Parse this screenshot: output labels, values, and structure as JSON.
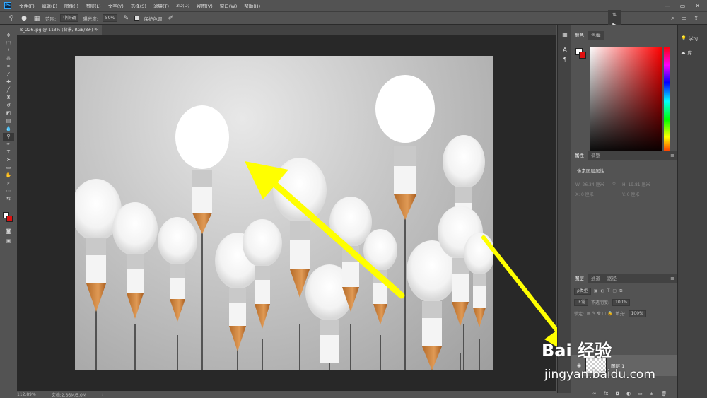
{
  "menubar": {
    "logo": "Ps",
    "items": [
      "文件(F)",
      "编辑(E)",
      "图像(I)",
      "图层(L)",
      "文字(Y)",
      "选择(S)",
      "滤镜(T)",
      "3D(D)",
      "视图(V)",
      "窗口(W)",
      "帮助(H)"
    ],
    "window_controls": [
      "—",
      "▭",
      "✕"
    ]
  },
  "options": {
    "range_label": "范围:",
    "range_value": "中间调",
    "exposure_label": "曝光度:",
    "exposure_value": "50%",
    "protect_tones_label": "保护色调"
  },
  "document": {
    "tab_title": "ls_226.jpg @ 113% (背景, RGB/8#) *",
    "close": "×"
  },
  "status": {
    "zoom": "112.89%",
    "doc_size": "文档:2.36M/5.0M",
    "arrow": "›"
  },
  "panels": {
    "color_tabs": [
      "颜色",
      "色板"
    ],
    "properties_tabs": [
      "属性",
      "调整"
    ],
    "properties_title": "像素图层属性",
    "prop_w": "W: 26.34 厘米",
    "prop_h": "H: 19.81 厘米",
    "prop_x": "X: 0 厘米",
    "prop_y": "Y: 0 厘米",
    "layers_tabs": [
      "图层",
      "通道",
      "路径"
    ],
    "layers_filter": "ρ类型",
    "blend_mode": "正常",
    "opacity_label": "不透明度:",
    "opacity_value": "100%",
    "lock_label": "锁定:",
    "fill_label": "填充:",
    "fill_value": "100%",
    "layer_name": "图层 1",
    "learn_label": "学习",
    "library_label": "库"
  },
  "watermark": {
    "logo": "Bai  经验",
    "url": "jingyan.baidu.com"
  },
  "colors": {
    "foreground": "#ffffff",
    "background": "#e01010",
    "arrow": "#ffff00"
  }
}
